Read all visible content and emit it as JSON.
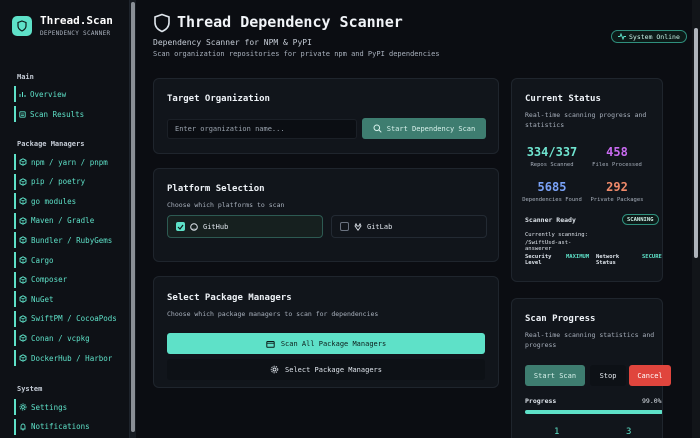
{
  "brand": {
    "title": "Thread.Scan",
    "subtitle": "DEPENDENCY SCANNER"
  },
  "sidebar": {
    "main_section": "Main",
    "main_items": [
      {
        "label": "Overview",
        "icon": "chart-icon"
      },
      {
        "label": "Scan Results",
        "icon": "list-icon"
      }
    ],
    "pm_section": "Package Managers",
    "pm_items": [
      "npm / yarn / pnpm",
      "pip / poetry",
      "go modules",
      "Maven / Gradle",
      "Bundler / RubyGems",
      "Cargo",
      "Composer",
      "NuGet",
      "SwiftPM / CocoaPods",
      "Conan / vcpkg",
      "DockerHub / Harbor"
    ],
    "system_section": "System",
    "system_items": [
      "Settings",
      "Notifications"
    ]
  },
  "header": {
    "title": "Thread Dependency Scanner",
    "subtitle": "Dependency Scanner for NPM & PyPI",
    "description": "Scan organization repositories for private npm and PyPI dependencies",
    "status": "System Online"
  },
  "target": {
    "title": "Target Organization",
    "placeholder": "Enter organization name...",
    "button": "Start Dependency Scan"
  },
  "platform": {
    "title": "Platform Selection",
    "subtitle": "Choose which platforms to scan",
    "options": [
      {
        "label": "GitHub",
        "checked": true
      },
      {
        "label": "GitLab",
        "checked": false
      }
    ]
  },
  "packages": {
    "title": "Select Package Managers",
    "subtitle": "Choose which package managers to scan for dependencies",
    "scan_all": "Scan All Package Managers",
    "select": "Select Package Managers"
  },
  "status_card": {
    "title": "Current Status",
    "subtitle": "Real-time scanning progress and statistics",
    "stats": [
      {
        "value": "334/337",
        "label": "Repos Scanned",
        "color": "#6fe3cf"
      },
      {
        "value": "458",
        "label": "Files Processed",
        "color": "#c86af0"
      },
      {
        "value": "5685",
        "label": "Dependencies Found",
        "color": "#7aa2f7"
      },
      {
        "value": "292",
        "label": "Private Packages",
        "color": "#f08a6a"
      }
    ],
    "scanner_label": "Scanner Ready",
    "scanner_badge": "SCANNING",
    "currently_label": "Currently scanning:",
    "currently_value": "/SwiftUsd-ast-answerer",
    "security_label": "Security Level",
    "security_value": "MAXIMUM",
    "network_label": "Network Status",
    "network_value": "SECURE"
  },
  "progress_card": {
    "title": "Scan Progress",
    "subtitle": "Real-time scanning statistics and progress",
    "start": "Start Scan",
    "stop": "Stop",
    "cancel": "Cancel",
    "progress_label": "Progress",
    "progress_value": "99.0%",
    "progress_fraction": 0.99,
    "counts": [
      "1",
      "3"
    ]
  },
  "colors": {
    "accent": "#5ee1c8",
    "danger": "#e0453d",
    "background": "#0b0d12"
  }
}
